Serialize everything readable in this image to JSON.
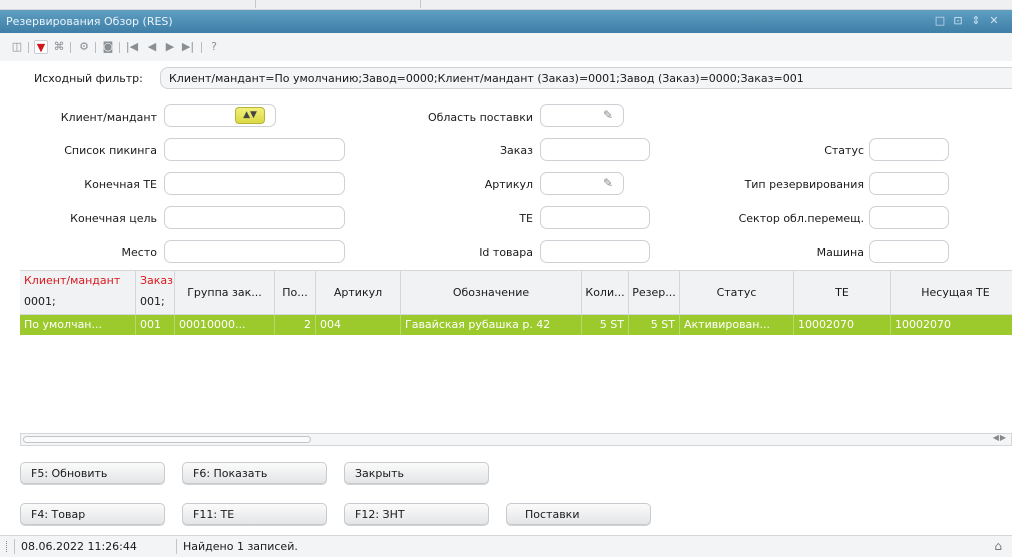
{
  "window": {
    "title": "Резервирования Обзор (RES)",
    "buttons": [
      "□",
      "⊡",
      "⇕",
      "✕"
    ]
  },
  "toolbar": {
    "icons": [
      "camera-icon",
      "filter-icon",
      "binoculars-icon",
      "settings-icon",
      "query-icon",
      "first-icon",
      "prev-icon",
      "next-icon",
      "last-icon",
      "help-icon"
    ]
  },
  "filter": {
    "label": "Исходный фильтр:",
    "value": "Клиент/мандант=По умолчанию;Завод=0000;Клиент/мандант (Заказ)=0001;Завод (Заказ)=0000;Заказ=001"
  },
  "form": {
    "client_label": "Клиент/мандант",
    "delivery_area_label": "Область поставки",
    "picking_list_label": "Список пикинга",
    "order_label": "Заказ",
    "status_label": "Статус",
    "final_hu_label": "Конечная ТЕ",
    "article_label": "Артикул",
    "reservation_type_label": "Тип резервирования",
    "final_target_label": "Конечная цель",
    "hu_label": "ТЕ",
    "move_sector_label": "Сектор обл.перемещ.",
    "place_label": "Место",
    "item_id_label": "Id товара",
    "machine_label": "Машина"
  },
  "grid": {
    "columns": [
      {
        "line1": "Клиент/мандант",
        "line2": "0001;"
      },
      {
        "line1": "Заказ",
        "line2": "001;"
      },
      {
        "label": "Группа зак..."
      },
      {
        "label": "По..."
      },
      {
        "label": "Артикул"
      },
      {
        "label": "Обозначение"
      },
      {
        "label": "Коли..."
      },
      {
        "label": "Резер..."
      },
      {
        "label": "Статус"
      },
      {
        "label": "ТЕ"
      },
      {
        "label": "Несущая ТЕ"
      }
    ],
    "rows": [
      [
        "По умолчан...",
        "001",
        "00010000...",
        "2",
        "004",
        "Гавайская рубашка  р. 42",
        "5  ST",
        "5  ST",
        "Активирован...",
        "10002070",
        "10002070"
      ]
    ]
  },
  "buttons": {
    "refresh": "F5: Обновить",
    "show": "F6: Показать",
    "close": "Закрыть",
    "item": "F4: Товар",
    "hu": "F11: ТЕ",
    "znt": "F12: ЗНТ",
    "deliveries": "Поставки"
  },
  "status": {
    "datetime": "08.06.2022 11:26:44",
    "message": "Найдено 1 записей."
  }
}
